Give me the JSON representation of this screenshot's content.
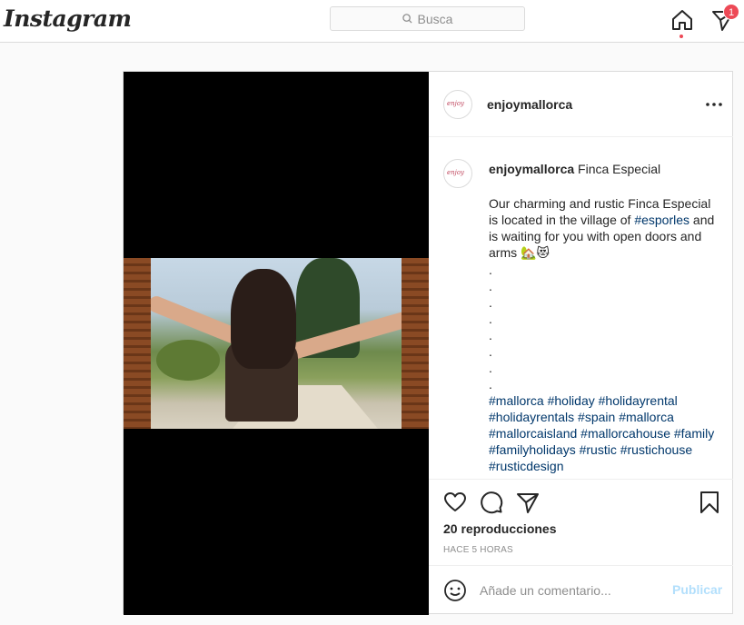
{
  "app": {
    "logo_text": "Instagram"
  },
  "search": {
    "placeholder": "Busca"
  },
  "nav": {
    "home_icon": "home-icon",
    "activity_icon": "heart-arrow-icon",
    "notification_count": "1"
  },
  "post": {
    "username": "enjoymallorca",
    "caption_title": "Finca Especial",
    "caption_text_1": "Our charming and rustic Finca Especial is located in the village of ",
    "caption_tag_village": "#esporles",
    "caption_text_2": " and is waiting for you with open doors and arms ",
    "caption_emoji": "🏡😻",
    "dots": [
      ".",
      ".",
      ".",
      ".",
      ".",
      ".",
      ".",
      "."
    ],
    "hashtags": "#mallorca #holiday #holidayrental #holidayrentals #spain #mallorca #mallorcaisland #mallorcahouse #family #familyholidays #rustic #rustichouse #rusticdesign",
    "views": "20 reproducciones",
    "time": "HACE 5 HORAS"
  },
  "comment": {
    "placeholder": "Añade un comentario...",
    "publish_label": "Publicar"
  },
  "colors": {
    "hashtag": "#00376b",
    "publish_disabled": "#b2dffc",
    "badge": "#ed4956"
  }
}
